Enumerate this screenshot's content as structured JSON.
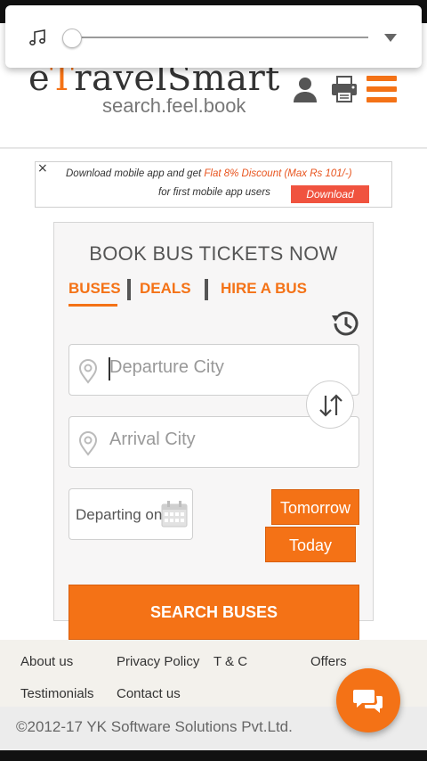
{
  "media_player": {
    "icon": "music-note-icon"
  },
  "header": {
    "logo_prefix": "e",
    "logo_highlight": "T",
    "logo_suffix": "ravelSmart",
    "tagline": "search.feel.book",
    "icons": [
      "user-icon",
      "printer-icon",
      "hamburger-menu-icon"
    ]
  },
  "promo": {
    "close": "×",
    "line1_prefix": "Download mobile app and get ",
    "line1_highlight": "Flat 8% Discount (Max Rs 101/-)",
    "line2": "for first mobile app users",
    "button": "Download"
  },
  "booking": {
    "title": "BOOK BUS TICKETS NOW",
    "tabs": [
      {
        "label": "BUSES",
        "active": true
      },
      {
        "label": "DEALS",
        "active": false
      },
      {
        "label": "HIRE A BUS",
        "active": false
      }
    ],
    "departure_placeholder": "Departure City",
    "arrival_placeholder": "Arrival City",
    "date_label": "Departing on",
    "tomorrow_button": "Tomorrow",
    "today_button": "Today",
    "search_button": "SEARCH BUSES"
  },
  "footer": {
    "links_row1": [
      "About us",
      "Privacy Policy",
      "T & C",
      "Offers"
    ],
    "links_row2": [
      "Testimonials",
      "Contact us"
    ],
    "copyright": "©2012-17 YK Software Solutions Pvt.Ltd."
  },
  "colors": {
    "accent": "#f47216",
    "promo_button": "#f0533f",
    "text": "#555555"
  }
}
